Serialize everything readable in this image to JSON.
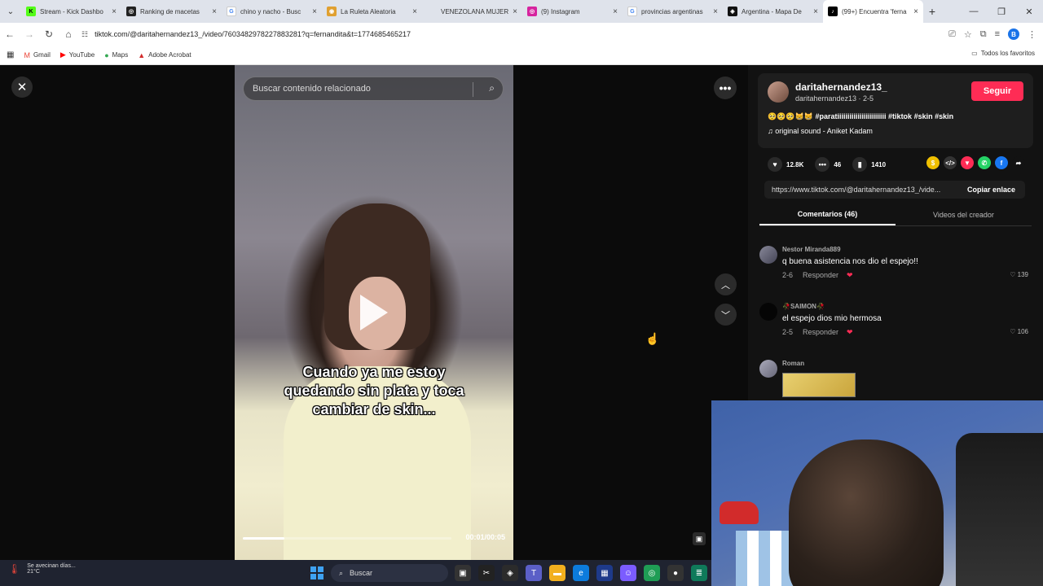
{
  "browser": {
    "tabs": [
      {
        "title": "Stream - Kick Dashbo",
        "fav_color": "#53fc18",
        "fav_text": "K"
      },
      {
        "title": "Ranking de macetas",
        "fav_color": "#222222",
        "fav_text": "◎"
      },
      {
        "title": "chino y nacho - Busc",
        "fav_color": "#4285f4",
        "fav_text": "G"
      },
      {
        "title": "La Ruleta Aleatoria",
        "fav_color": "#e0a030",
        "fav_text": "◉"
      },
      {
        "title": "VENEZOLANA MUJER",
        "fav_color": "#dfe3eb",
        "fav_text": ""
      },
      {
        "title": "(9) Instagram",
        "fav_color": "#d6249f",
        "fav_text": "◎"
      },
      {
        "title": "provincias argentinas",
        "fav_color": "#4285f4",
        "fav_text": "G"
      },
      {
        "title": "Argentina - Mapa De",
        "fav_color": "#111111",
        "fav_text": "◈"
      },
      {
        "title": "(99+) Encuentra 'ferna",
        "fav_color": "#000000",
        "fav_text": "♪"
      }
    ],
    "url": "tiktok.com/@daritahernandez13_/video/7603482978227883281?q=fernandita&t=1774685465217",
    "profile_initial": "B",
    "bookmarks": [
      {
        "label": "Gmail",
        "icon": "M",
        "color": "#ea4335"
      },
      {
        "label": "YouTube",
        "icon": "▶",
        "color": "#ff0000"
      },
      {
        "label": "Maps",
        "icon": "●",
        "color": "#34a853"
      },
      {
        "label": "Adobe Acrobat",
        "icon": "▲",
        "color": "#d22b2b"
      }
    ],
    "all_bookmarks_label": "Todos los favoritos"
  },
  "video": {
    "search_placeholder": "Buscar contenido relacionado",
    "caption_line1": "Cuando ya me estoy",
    "caption_line2": "quedando sin plata y toca",
    "caption_line3": "cambiar de skin...",
    "time": "00:01/00:05",
    "progress": 0.2
  },
  "creator": {
    "username": "daritahernandez13_",
    "subline": "daritahernandez13 · 2-5",
    "follow_label": "Seguir",
    "description": "🥺🥺🥺😸😸 #paratiiiiiiiiiiiiiiiiiiiiiiii #tiktok #skin #skin",
    "sound": "original sound - Aniket Kadam"
  },
  "stats": {
    "likes": "12.8K",
    "comments": "46",
    "saves": "1410"
  },
  "share": [
    {
      "name": "coin-icon",
      "color": "#f0c000",
      "glyph": "$"
    },
    {
      "name": "embed-icon",
      "color": "#333333",
      "glyph": "</>"
    },
    {
      "name": "send-icon",
      "color": "#fe2c55",
      "glyph": "▼"
    },
    {
      "name": "whatsapp-icon",
      "color": "#25d366",
      "glyph": "✆"
    },
    {
      "name": "facebook-icon",
      "color": "#1877f2",
      "glyph": "f"
    },
    {
      "name": "share-arrow-icon",
      "color": "#121212",
      "glyph": "➦"
    }
  ],
  "link": {
    "url": "https://www.tiktok.com/@daritahernandez13_/vide...",
    "copy_label": "Copiar enlace"
  },
  "panel_tabs": {
    "comments": "Comentarios (46)",
    "creator_videos": "Videos del creador"
  },
  "comments": [
    {
      "user": "Nestor Miranda889",
      "text": "q buena asistencia nos dio el espejo!!",
      "date": "2-6",
      "reply": "Responder",
      "likes": "139"
    },
    {
      "user": "🥀SAIMON🥀",
      "text": "el espejo dios mio hermosa",
      "date": "2-5",
      "reply": "Responder",
      "likes": "106"
    },
    {
      "user": "Roman"
    }
  ],
  "taskbar": {
    "weather_title": "Se avecinan días...",
    "weather_temp": "21°C",
    "search_label": "Buscar"
  }
}
